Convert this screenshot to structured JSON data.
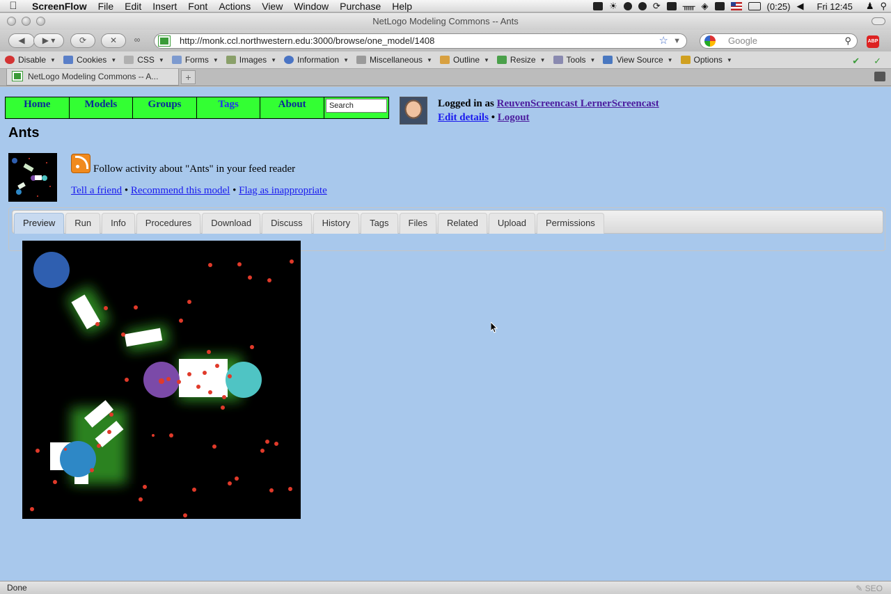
{
  "menubar": {
    "app": "ScreenFlow",
    "items": [
      "File",
      "Edit",
      "Insert",
      "Font",
      "Actions",
      "View",
      "Window",
      "Purchase",
      "Help"
    ],
    "battery": "(0:25)",
    "clock": "Fri 12:45"
  },
  "window": {
    "title": "NetLogo Modeling Commons -- Ants"
  },
  "browser": {
    "url": "http://monk.ccl.northwestern.edu:3000/browse/one_model/1408",
    "search_placeholder": "Google",
    "tab_title": "NetLogo Modeling Commons -- A...",
    "status": "Done"
  },
  "devbar": {
    "items": [
      {
        "label": "Disable",
        "icon": "disable-icon",
        "color": "#d33333"
      },
      {
        "label": "Cookies",
        "icon": "cookies-icon",
        "color": "#5a7fc8"
      },
      {
        "label": "CSS",
        "icon": "css-icon",
        "color": "#b0b0b0"
      },
      {
        "label": "Forms",
        "icon": "forms-icon",
        "color": "#7d9acf"
      },
      {
        "label": "Images",
        "icon": "images-icon",
        "color": "#8aa06a"
      },
      {
        "label": "Information",
        "icon": "information-icon",
        "color": "#4a74c4"
      },
      {
        "label": "Miscellaneous",
        "icon": "miscellaneous-icon",
        "color": "#9a9a9a"
      },
      {
        "label": "Outline",
        "icon": "outline-icon",
        "color": "#d8a040"
      },
      {
        "label": "Resize",
        "icon": "resize-icon",
        "color": "#4aa04a"
      },
      {
        "label": "Tools",
        "icon": "tools-icon",
        "color": "#8a8ab0"
      },
      {
        "label": "View Source",
        "icon": "view-source-icon",
        "color": "#4a78c0"
      },
      {
        "label": "Options",
        "icon": "options-icon",
        "color": "#d0a020"
      }
    ]
  },
  "site": {
    "nav": [
      "Home",
      "Models",
      "Groups",
      "Tags",
      "About"
    ],
    "search_value": "Search",
    "logged_in_prefix": "Logged in as",
    "user_name": "ReuvenScreencast LernerScreencast",
    "edit_details": "Edit details",
    "separator": "•",
    "logout": "Logout"
  },
  "model": {
    "title": "Ants",
    "follow_text": "Follow activity about \"Ants\" in your feed reader",
    "tell_friend": "Tell a friend",
    "recommend": "Recommend this model",
    "flag": "Flag as inappropriate",
    "tabs": [
      "Preview",
      "Run",
      "Info",
      "Procedures",
      "Download",
      "Discuss",
      "History",
      "Tags",
      "Files",
      "Related",
      "Upload",
      "Permissions"
    ],
    "active_tab": "Preview"
  },
  "colors": {
    "page_bg": "#a8c8ec",
    "nav_green": "#33ff33",
    "link_blue": "#1a1aee",
    "visited_purple": "#4b1c9e",
    "nest_purple": "#7b4aa8",
    "food_blue": "#2f5fb0",
    "food_cyan": "#4fc4c4",
    "food_lightblue": "#2e88c6",
    "ant_red": "#e03a2a"
  }
}
